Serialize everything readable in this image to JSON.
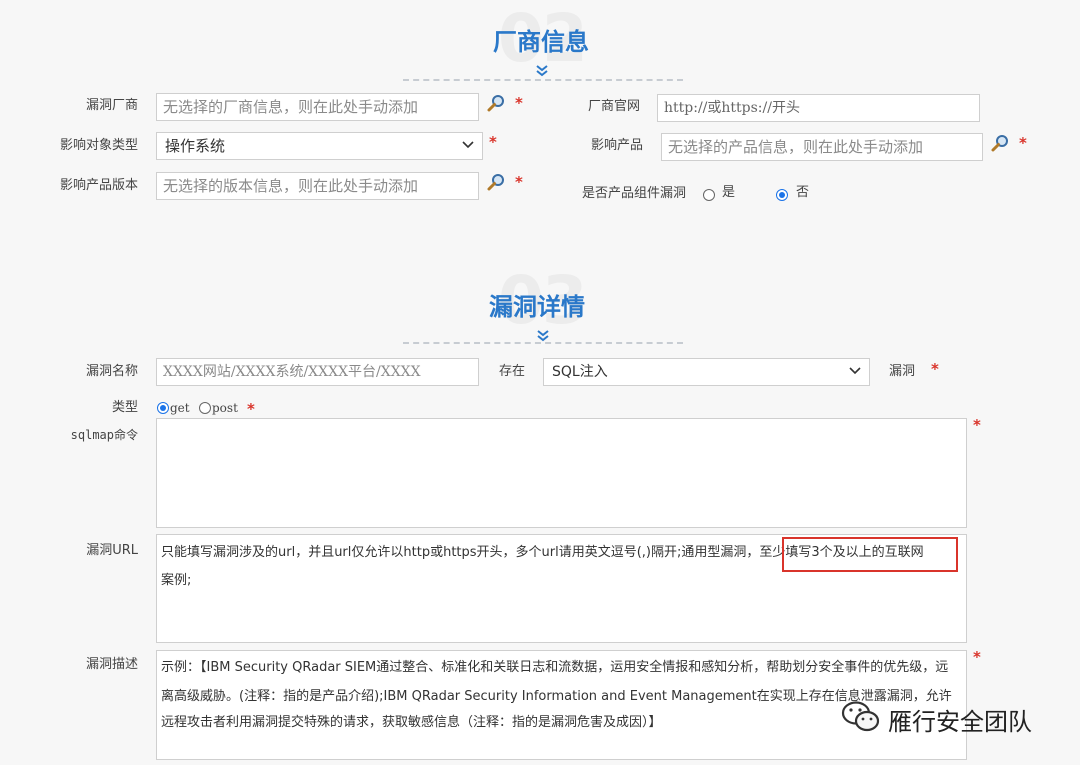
{
  "vendor_section": {
    "number": "02",
    "title": "厂商信息",
    "vuln_vendor": {
      "label": "漏洞厂商",
      "placeholder": "无选择的厂商信息，则在此处手动添加"
    },
    "vendor_site": {
      "label": "厂商官网",
      "placeholder": "http://或https://开头"
    },
    "target_type": {
      "label": "影响对象类型",
      "value": "操作系统"
    },
    "affected_product": {
      "label": "影响产品",
      "placeholder": "无选择的产品信息，则在此处手动添加"
    },
    "product_version": {
      "label": "影响产品版本",
      "placeholder": "无选择的版本信息，则在此处手动添加"
    },
    "component_vuln": {
      "label": "是否产品组件漏洞",
      "options": [
        "是",
        "否"
      ],
      "selected": "否"
    }
  },
  "detail_section": {
    "number": "03",
    "title": "漏洞详情",
    "name": {
      "label": "漏洞名称",
      "placeholder": "XXXX网站/XXXX系统/XXXX平台/XXXX",
      "exists_label": "存在",
      "type_value": "SQL注入",
      "suffix": "漏洞"
    },
    "type": {
      "label": "类型",
      "options": [
        "get",
        "post"
      ],
      "selected": "get"
    },
    "sqlmap": {
      "label": "sqlmap命令",
      "value": ""
    },
    "url": {
      "label": "漏洞URL",
      "text_line1": "只能填写漏洞涉及的url，并且url仅允许以http或https开头，多个url请用英文逗号(,)隔开;通用型漏洞，",
      "text_highlight": "至少填写3个及以上的互联网",
      "text_line2": "案例;"
    },
    "description": {
      "label": "漏洞描述",
      "lines": [
        "示例：【IBM Security QRadar SIEM通过整合、标准化和关联日志和流数据，运用安全情报和感知分析，帮助划分安全事件的优先级，远",
        "离高级威胁。(注释：指的是产品介绍);IBM QRadar Security Information and Event Management在实现上存在信息泄露漏洞，允许",
        "远程攻击者利用漏洞提交特殊的请求，获取敏感信息（注释：指的是漏洞危害及成因）】"
      ]
    }
  },
  "required_mark": "*",
  "watermark": "雁行安全团队",
  "colors": {
    "accent": "#2a78c9",
    "required": "#d9342b",
    "radio": "#1a73e8"
  },
  "icons": {
    "search": "magnifier-icon",
    "dropdown": "chevron-down-icon",
    "section": "double-chevron-icon",
    "watermark": "wechat-icon"
  }
}
